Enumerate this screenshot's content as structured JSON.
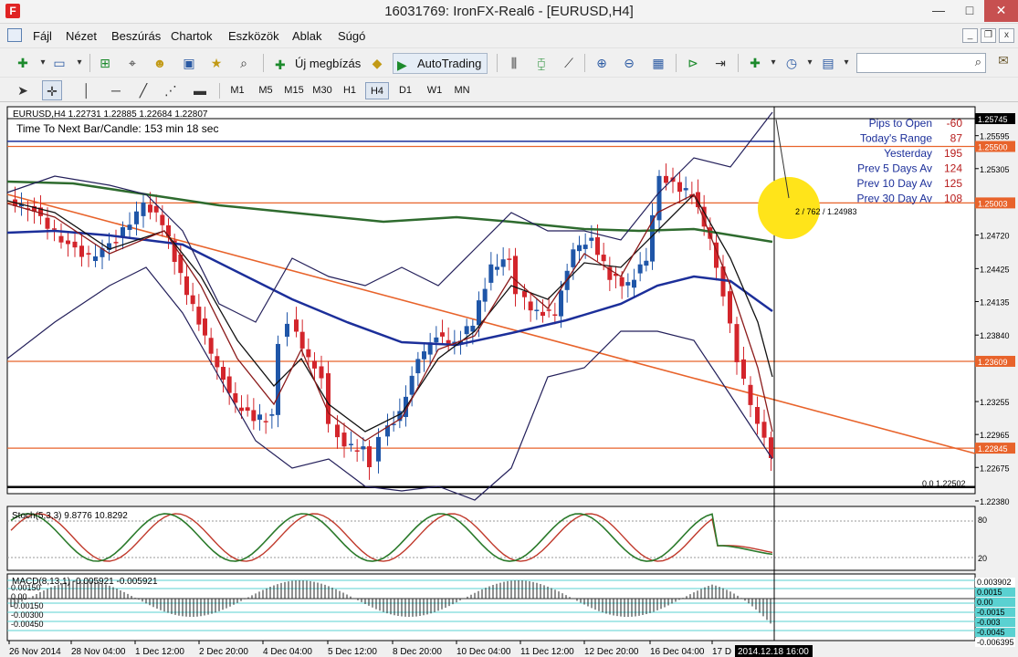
{
  "window": {
    "title": "16031769: IronFX-Real6 - [EURUSD,H4]",
    "min": "—",
    "max": "□",
    "close": "✕"
  },
  "menu": [
    "Fájl",
    "Nézet",
    "Beszúrás",
    "Chartok",
    "Eszközök",
    "Ablak",
    "Súgó"
  ],
  "toolbar": {
    "new_order_label": "Új megbízás",
    "autotrading_label": "AutoTrading",
    "search_placeholder": "",
    "timeframes": [
      "M1",
      "M5",
      "M15",
      "M30",
      "H1",
      "H4",
      "D1",
      "W1",
      "MN"
    ],
    "active_timeframe": "H4"
  },
  "chart": {
    "header": "EURUSD,H4  1.22731 1.22885 1.22684 1.22807",
    "timer_label": "Time To Next Bar/Candle: 153 min 18 sec",
    "stats": [
      {
        "label": "Pips to Open",
        "value": "-60"
      },
      {
        "label": "Today's Range",
        "value": "87"
      },
      {
        "label": "Yesterday",
        "value": "195"
      },
      {
        "label": "Prev 5 Days Av",
        "value": "124"
      },
      {
        "label": "Prev 10 Day Av",
        "value": "125"
      },
      {
        "label": "Prev 30 Day Av",
        "value": "108"
      }
    ],
    "crosshair_label": "2 / 762 / 1.24983",
    "fib_label": "0.0 1.22502",
    "price_ticks": [
      "1.25595",
      "1.25305",
      "1.24720",
      "1.24425",
      "1.24135",
      "1.23840",
      "1.23255",
      "1.22965",
      "1.22675",
      "1.22380"
    ],
    "highlight_prices": [
      {
        "value": "1.25745",
        "style": "dark"
      },
      {
        "value": "1.25500",
        "style": "orange"
      },
      {
        "value": "1.25003",
        "style": "orange"
      },
      {
        "value": "1.23609",
        "style": "orange"
      },
      {
        "value": "1.22845",
        "style": "orange"
      }
    ],
    "time_ticks": [
      "26 Nov 2014",
      "28 Nov 04:00",
      "1 Dec 12:00",
      "2 Dec 20:00",
      "4 Dec 04:00",
      "5 Dec 12:00",
      "8 Dec 20:00",
      "10 Dec 04:00",
      "11 Dec 12:00",
      "12 Dec 20:00",
      "16 Dec 04:00",
      "17 D"
    ],
    "time_cursor_label": "2014.12.18 16:00",
    "stoch_label": "Stoch(5,3,3) 9.8776 10.8292",
    "stoch_levels": [
      "80",
      "20"
    ],
    "macd_label": "MACD(8,13,1) -0.005921 -0.005921",
    "macd_left_ticks": [
      "0.00150",
      "0.00",
      "-0.00150",
      "-0.00300",
      "-0.00450"
    ],
    "macd_right_ticks": [
      "0.003902",
      "0.0015",
      "0.00",
      "-0.0015",
      "-0.003",
      "-0.0045",
      "-0.006395"
    ],
    "colors": {
      "bull": "#1f56a8",
      "bear": "#d3252b",
      "ma_green": "#2e6b2e",
      "ma_blue": "#1c2f9a",
      "bands": "#231f5a",
      "trend": "#e8632b",
      "hline": "#e8632b",
      "stoch_k": "#2b7a2b",
      "stoch_d": "#c0392b",
      "macd_lines": "#5ad1d1",
      "highlight": "#ffe41a"
    }
  }
}
